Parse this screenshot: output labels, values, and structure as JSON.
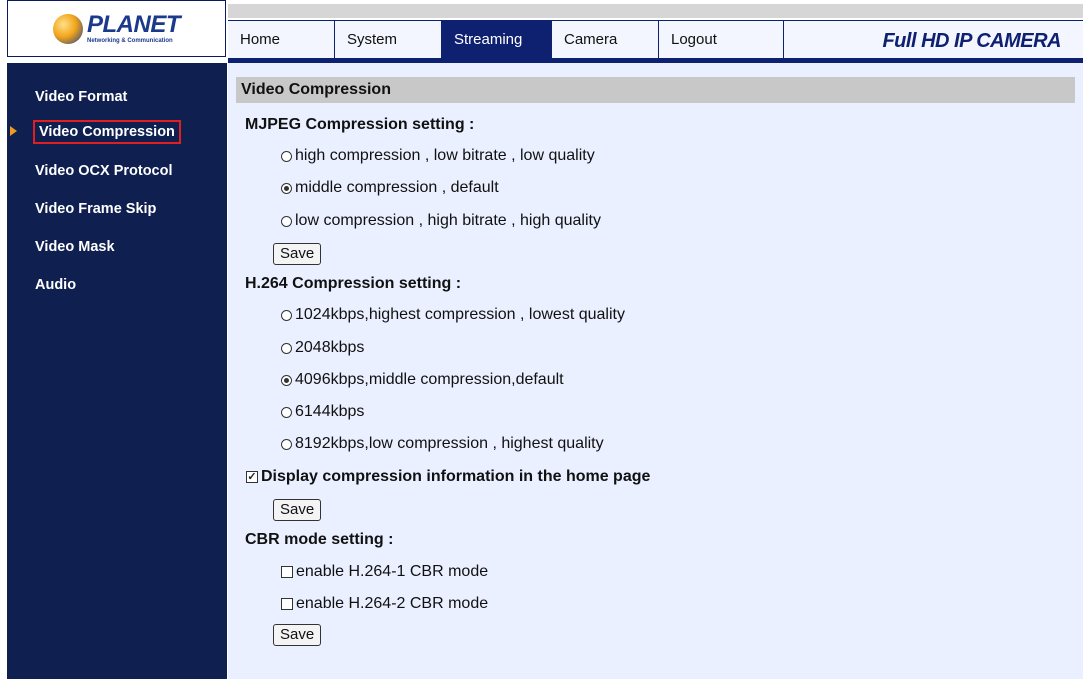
{
  "header": {
    "logo_main": "PLANET",
    "logo_sub": "Networking & Communication",
    "brand": "Full HD IP CAMERA",
    "tabs": [
      {
        "label": "Home"
      },
      {
        "label": "System"
      },
      {
        "label": "Streaming"
      },
      {
        "label": "Camera"
      },
      {
        "label": "Logout"
      }
    ],
    "active_tab": "Streaming"
  },
  "sidebar": {
    "items": [
      {
        "label": "Video Format"
      },
      {
        "label": "Video Compression"
      },
      {
        "label": "Video OCX Protocol"
      },
      {
        "label": "Video Frame Skip"
      },
      {
        "label": "Video Mask"
      },
      {
        "label": "Audio"
      }
    ],
    "active_item": "Video Compression"
  },
  "main": {
    "title": "Video Compression",
    "mjpeg": {
      "title": "MJPEG Compression setting :",
      "options": [
        {
          "label": "high compression , low bitrate , low quality",
          "selected": false
        },
        {
          "label": "middle compression , default",
          "selected": true
        },
        {
          "label": "low compression , high bitrate , high quality",
          "selected": false
        }
      ],
      "save_label": "Save"
    },
    "h264": {
      "title": "H.264 Compression setting :",
      "options": [
        {
          "label": "1024kbps,highest compression , lowest quality",
          "selected": false
        },
        {
          "label": "2048kbps",
          "selected": false
        },
        {
          "label": "4096kbps,middle compression,default",
          "selected": true
        },
        {
          "label": "6144kbps",
          "selected": false
        },
        {
          "label": "8192kbps,low compression , highest quality",
          "selected": false
        }
      ],
      "display_info_label": "Display compression information in the home page",
      "display_info_checked": true,
      "save_label": "Save"
    },
    "cbr": {
      "title": "CBR mode setting :",
      "options": [
        {
          "label": "enable H.264-1 CBR mode",
          "checked": false
        },
        {
          "label": "enable H.264-2 CBR mode",
          "checked": false
        }
      ],
      "save_label": "Save"
    }
  },
  "colors": {
    "navy": "#0e2070",
    "sidebar_bg": "#0f1f50",
    "content_bg": "#eaf0ff",
    "highlight_border": "#e02020",
    "arrow": "#f29a1c"
  }
}
